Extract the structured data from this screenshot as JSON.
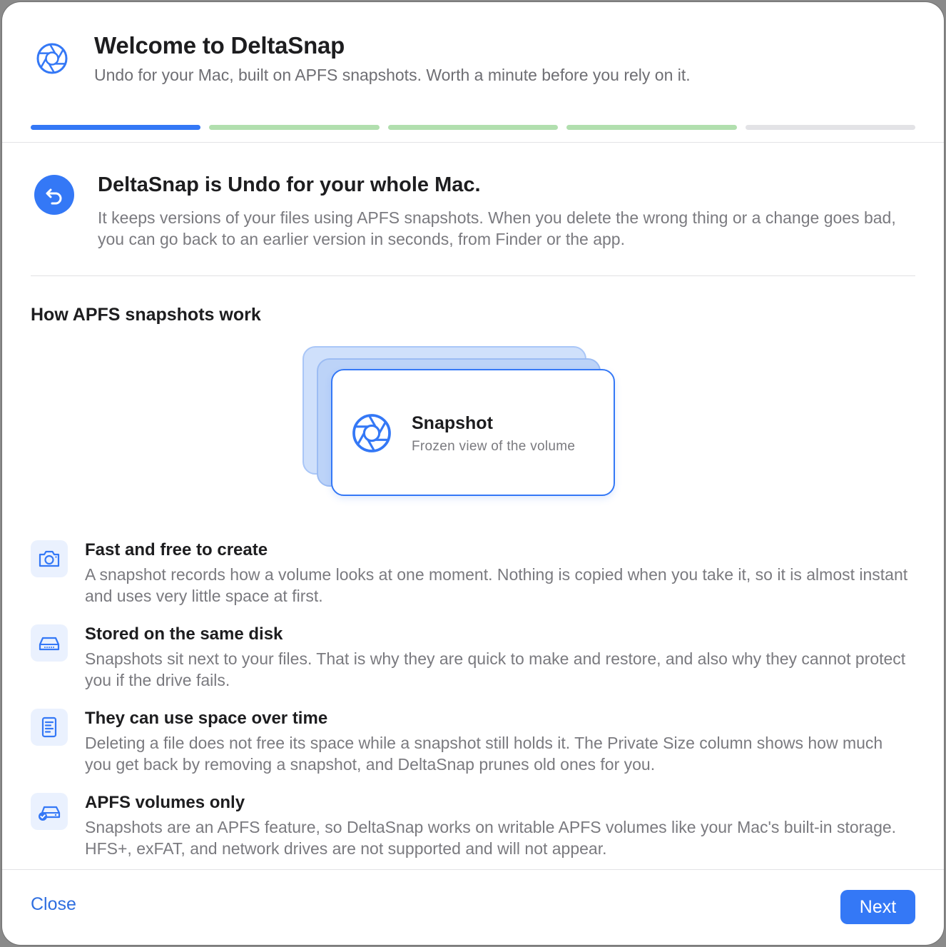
{
  "header": {
    "app_icon": "aperture-icon",
    "title": "Welcome to DeltaSnap",
    "subtitle": "Undo for your Mac, built on APFS snapshots. Worth a minute before you rely on it."
  },
  "progress": {
    "total_steps": 5,
    "current_step": 1,
    "steps": [
      {
        "state": "current",
        "color": "#3478f6"
      },
      {
        "state": "upcoming",
        "color": "#b1dfae"
      },
      {
        "state": "upcoming",
        "color": "#b1dfae"
      },
      {
        "state": "upcoming",
        "color": "#b1dfae"
      },
      {
        "state": "upcoming",
        "color": "#e3e3e6"
      }
    ]
  },
  "intro": {
    "icon": "undo-arrow-icon",
    "title": "DeltaSnap is Undo for your whole Mac.",
    "text": "It keeps versions of your files using APFS snapshots. When you delete the wrong thing or a change goes bad, you can go back to an earlier version in seconds, from Finder or the app."
  },
  "section": {
    "title": "How APFS snapshots work"
  },
  "snapshot_card": {
    "icon": "aperture-icon",
    "title": "Snapshot",
    "subtitle": "Frozen view of the volume"
  },
  "features": [
    {
      "icon": "camera-icon",
      "title": "Fast and free to create",
      "text": "A snapshot records how a volume looks at one moment. Nothing is copied when you take it, so it is almost instant and uses very little space at first."
    },
    {
      "icon": "internal-drive-icon",
      "title": "Stored on the same disk",
      "text": "Snapshots sit next to your files. That is why they are quick to make and restore, and also why they cannot protect you if the drive fails."
    },
    {
      "icon": "document-icon",
      "title": "They can use space over time",
      "text": "Deleting a file does not free its space while a snapshot still holds it. The Private Size column shows how much you get back by removing a snapshot, and DeltaSnap prunes old ones for you."
    },
    {
      "icon": "drive-checkmark-icon",
      "title": "APFS volumes only",
      "text": "Snapshots are an APFS feature, so DeltaSnap works on writable APFS volumes like your Mac's built-in storage. HFS+, exFAT, and network drives are not supported and will not appear."
    }
  ],
  "footer": {
    "close_label": "Close",
    "next_label": "Next"
  },
  "colors": {
    "accent": "#3478f6",
    "link": "#2f6fe0",
    "icon_tile": "#eaf1fe"
  }
}
